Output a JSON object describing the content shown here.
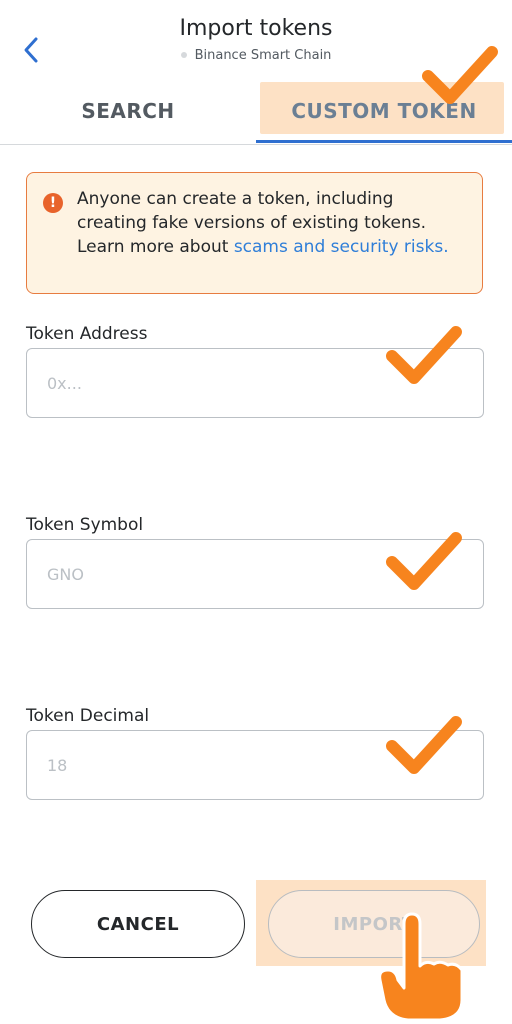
{
  "header": {
    "title": "Import tokens",
    "network": "Binance Smart Chain"
  },
  "tabs": [
    {
      "label": "SEARCH",
      "active": false
    },
    {
      "label": "CUSTOM TOKEN",
      "active": true
    }
  ],
  "warning": {
    "text": "Anyone can create a token, including creating fake versions of existing tokens. Learn more about ",
    "link": "scams and security risks."
  },
  "form": {
    "address": {
      "label": "Token Address",
      "placeholder": "0x..."
    },
    "symbol": {
      "label": "Token Symbol",
      "placeholder": "GNO"
    },
    "decimal": {
      "label": "Token Decimal",
      "placeholder": "18"
    }
  },
  "buttons": {
    "cancel": "CANCEL",
    "import": "IMPORT"
  },
  "colors": {
    "accent": "#2F6FD0",
    "highlight": "#FDE1C5",
    "annotation": "#F7841E",
    "warning_border": "#E77C40"
  }
}
